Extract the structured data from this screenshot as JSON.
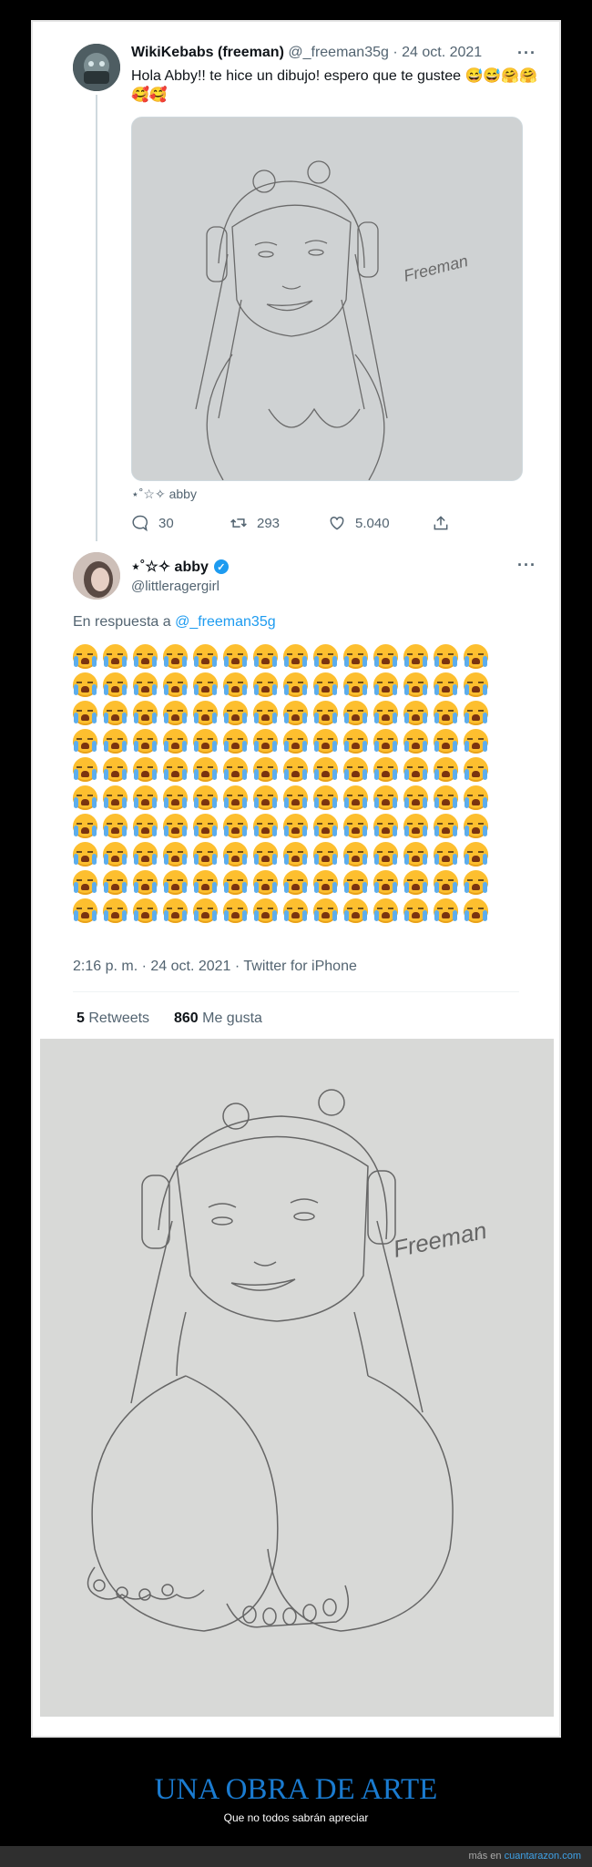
{
  "tweet1": {
    "display_name": "WikiKebabs (freeman)",
    "handle": "@_freeman35g",
    "separator": "·",
    "date": "24 oct. 2021",
    "text": "Hola Abby!! te hice un dibujo! espero que te gustee 😅😅🤗🤗🥰🥰",
    "media_tag": "⋆˚☆✧ abby",
    "replies": "30",
    "retweets": "293",
    "likes": "5.040",
    "more_icon": "more-icon"
  },
  "tweet2": {
    "display_name": "⋆˚☆✧ abby",
    "handle": "@littleragergirl",
    "verified": true,
    "reply_prefix": "En respuesta a",
    "reply_handle": "@_freeman35g",
    "emoji_name": "loudly-crying-face",
    "emoji_count": 140,
    "timestamp": "2:16 p. m. · 24 oct. 2021 · Twitter for iPhone",
    "retweets_count": "5",
    "retweets_label": "Retweets",
    "likes_count": "860",
    "likes_label": "Me gusta"
  },
  "drawing": {
    "signature": "Freeman"
  },
  "caption": {
    "title": "UNA OBRA DE ARTE",
    "subtitle": "Que no todos sabrán apreciar"
  },
  "footer": {
    "prefix": "más en",
    "site": "cuantarazon.com"
  },
  "colors": {
    "accent": "#1d9bf0",
    "title": "#1a7bd0",
    "emoji": "#fdbf2f"
  }
}
